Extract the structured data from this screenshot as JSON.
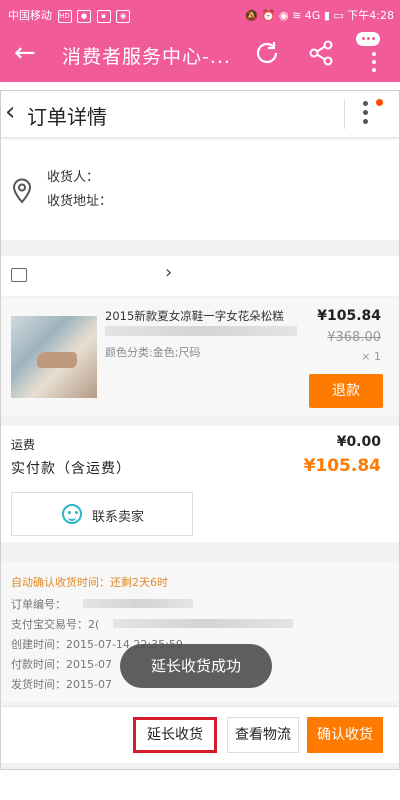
{
  "status_bar": {
    "carrier": "中国移动",
    "network": "4G",
    "time": "下午4:28"
  },
  "app_bar": {
    "title": "消费者服务中心-..."
  },
  "order": {
    "title": "订单详情",
    "consignee_label": "收货人：",
    "address_label": "收货地址：",
    "item": {
      "name": "2015新款夏女凉鞋一字女花朵松糕",
      "sku": "颜色分类:金色;尺码",
      "price": "¥105.84",
      "original_price": "¥368.00",
      "quantity": "× 1",
      "refund_label": "退款"
    },
    "freight_label": "运费",
    "freight_value": "¥0.00",
    "paid_label": "实付款（含运费）",
    "paid_value": "¥105.84",
    "contact_seller_label": "联系卖家"
  },
  "info": {
    "auto_confirm": "自动确认收货时间：还剩2天6时",
    "order_no_label": "订单编号：",
    "alipay_no_label": "支付宝交易号：",
    "alipay_no_partial": "2(",
    "created_label": "创建时间：",
    "created_value": "2015-07-14 22:35:59",
    "paid_label": "付款时间：",
    "paid_value": "2015-07",
    "shipped_label": "发货时间：",
    "shipped_value": "2015-07"
  },
  "toast": "延长收货成功",
  "actions": {
    "extend": "延长收货",
    "logistics": "查看物流",
    "confirm": "确认收货"
  },
  "colors": {
    "brand_pink": "#f25b9a",
    "accent_orange": "#ff7a00",
    "highlight_red": "#d81a2a"
  }
}
